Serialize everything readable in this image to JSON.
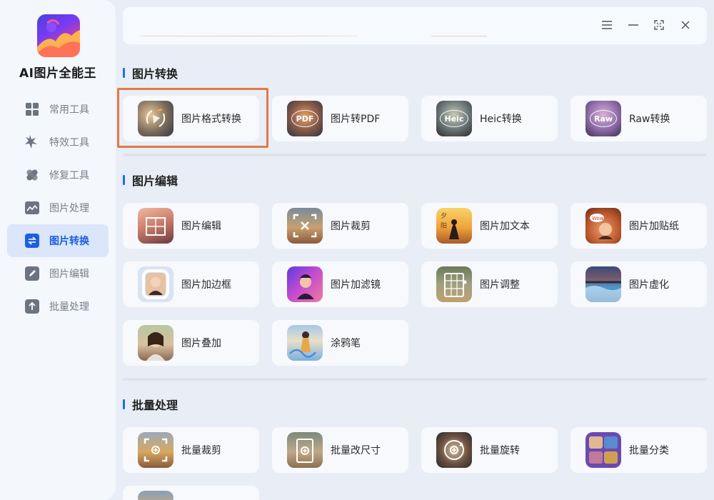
{
  "app": {
    "title": "AI图片全能王"
  },
  "sidebar": {
    "items": [
      {
        "label": "常用工具",
        "icon": "grid-icon",
        "active": false
      },
      {
        "label": "特效工具",
        "icon": "star-burst-icon",
        "active": false
      },
      {
        "label": "修复工具",
        "icon": "bandage-icon",
        "active": false
      },
      {
        "label": "图片处理",
        "icon": "image-icon",
        "active": false
      },
      {
        "label": "图片转换",
        "icon": "convert-icon",
        "active": true
      },
      {
        "label": "图片编辑",
        "icon": "edit-icon",
        "active": false
      },
      {
        "label": "批量处理",
        "icon": "upload-icon",
        "active": false
      }
    ]
  },
  "window_controls": [
    "menu-icon",
    "minimize-icon",
    "fullscreen-icon",
    "close-icon"
  ],
  "sections": {
    "convert": {
      "title": "图片转换",
      "cards": [
        {
          "label": "图片格式转换",
          "icon": "format-convert-icon",
          "selected": true
        },
        {
          "label": "图片转PDF",
          "icon": "pdf-icon",
          "badge": "PDF"
        },
        {
          "label": "Heic转换",
          "icon": "heic-icon",
          "badge": "Heic"
        },
        {
          "label": "Raw转换",
          "icon": "raw-icon",
          "badge": "Raw"
        }
      ]
    },
    "edit": {
      "title": "图片编辑",
      "cards": [
        {
          "label": "图片编辑",
          "icon": "image-edit-icon"
        },
        {
          "label": "图片裁剪",
          "icon": "crop-icon"
        },
        {
          "label": "图片加文本",
          "icon": "add-text-icon"
        },
        {
          "label": "图片加贴纸",
          "icon": "sticker-icon"
        },
        {
          "label": "图片加边框",
          "icon": "frame-icon"
        },
        {
          "label": "图片加滤镜",
          "icon": "filter-icon"
        },
        {
          "label": "图片调整",
          "icon": "adjust-icon"
        },
        {
          "label": "图片虚化",
          "icon": "blur-icon"
        },
        {
          "label": "图片叠加",
          "icon": "overlay-icon"
        },
        {
          "label": "涂鸦笔",
          "icon": "doodle-pen-icon"
        }
      ]
    },
    "batch": {
      "title": "批量处理",
      "cards": [
        {
          "label": "批量裁剪",
          "icon": "batch-crop-icon"
        },
        {
          "label": "批量改尺寸",
          "icon": "batch-resize-icon"
        },
        {
          "label": "批量旋转",
          "icon": "batch-rotate-icon"
        },
        {
          "label": "批量分类",
          "icon": "batch-classify-icon"
        }
      ]
    }
  },
  "colors": {
    "accent": "#1d6ff0",
    "highlight": "#e07a48",
    "active_bg": "#dbe6fb"
  }
}
